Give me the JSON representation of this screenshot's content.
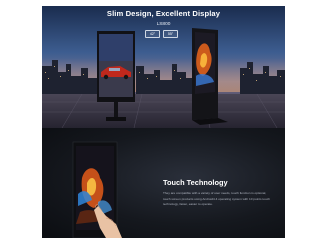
{
  "hero": {
    "title": "Slim Design, Excellent Display",
    "model": "LS800",
    "sizes": [
      "42\"",
      "55\""
    ]
  },
  "touch": {
    "title": "Touch Technology",
    "description": "They are compatible with a variety of user needs, touch function is optional, touch screen products using Android4.4 operating system with 10 points touch technology, faster, easier to operate."
  },
  "colors": {
    "sky_top": "#1a2c4e",
    "sky_mid": "#3d5d90",
    "dusk": "#7a7694",
    "touch_bg": "#15181e",
    "car_red": "#c0281c"
  },
  "icons": [
    "kiosk-with-car-image",
    "kiosk-with-fire-artwork",
    "hand-pointer"
  ]
}
